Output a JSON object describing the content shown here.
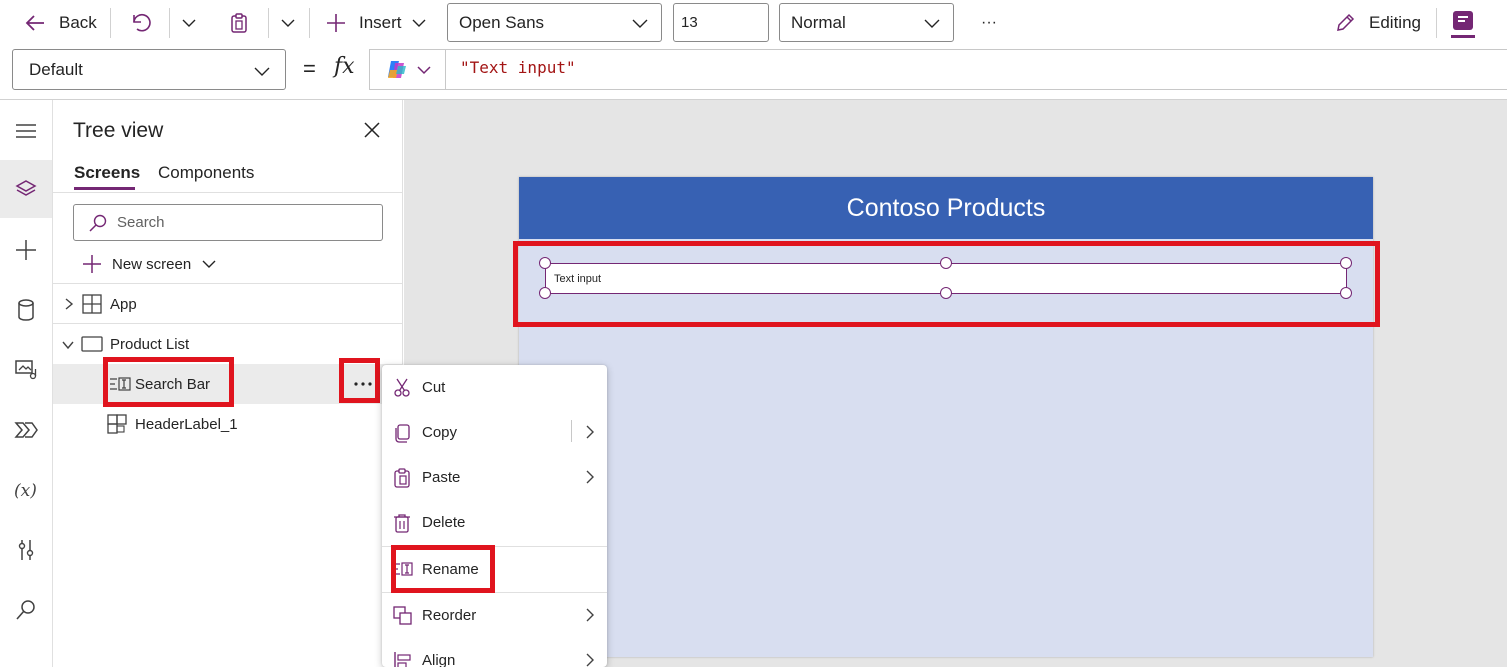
{
  "toolbar": {
    "back_label": "Back",
    "insert_label": "Insert",
    "font_name": "Open Sans",
    "font_size": "13",
    "font_weight": "Normal",
    "more_label": "···",
    "editing_label": "Editing"
  },
  "formula_bar": {
    "property": "Default",
    "equals": "=",
    "fx": "fx",
    "formula": "\"Text input\""
  },
  "tree_view": {
    "title": "Tree view",
    "tabs": [
      "Screens",
      "Components"
    ],
    "active_tab": "Screens",
    "search_placeholder": "Search",
    "new_screen_label": "New screen",
    "items": [
      {
        "label": "App"
      },
      {
        "label": "Product List"
      },
      {
        "label": "Search Bar"
      },
      {
        "label": "HeaderLabel_1"
      }
    ]
  },
  "canvas": {
    "header_text": "Contoso Products",
    "input_text": "Text input"
  },
  "context_menu": {
    "items": [
      "Cut",
      "Copy",
      "Paste",
      "Delete",
      "Rename",
      "Reorder",
      "Align"
    ]
  },
  "colors": {
    "accent": "#742774",
    "header_blue": "#3761b3",
    "screen_bg": "#d8def0",
    "highlight_red": "#e0141e"
  }
}
